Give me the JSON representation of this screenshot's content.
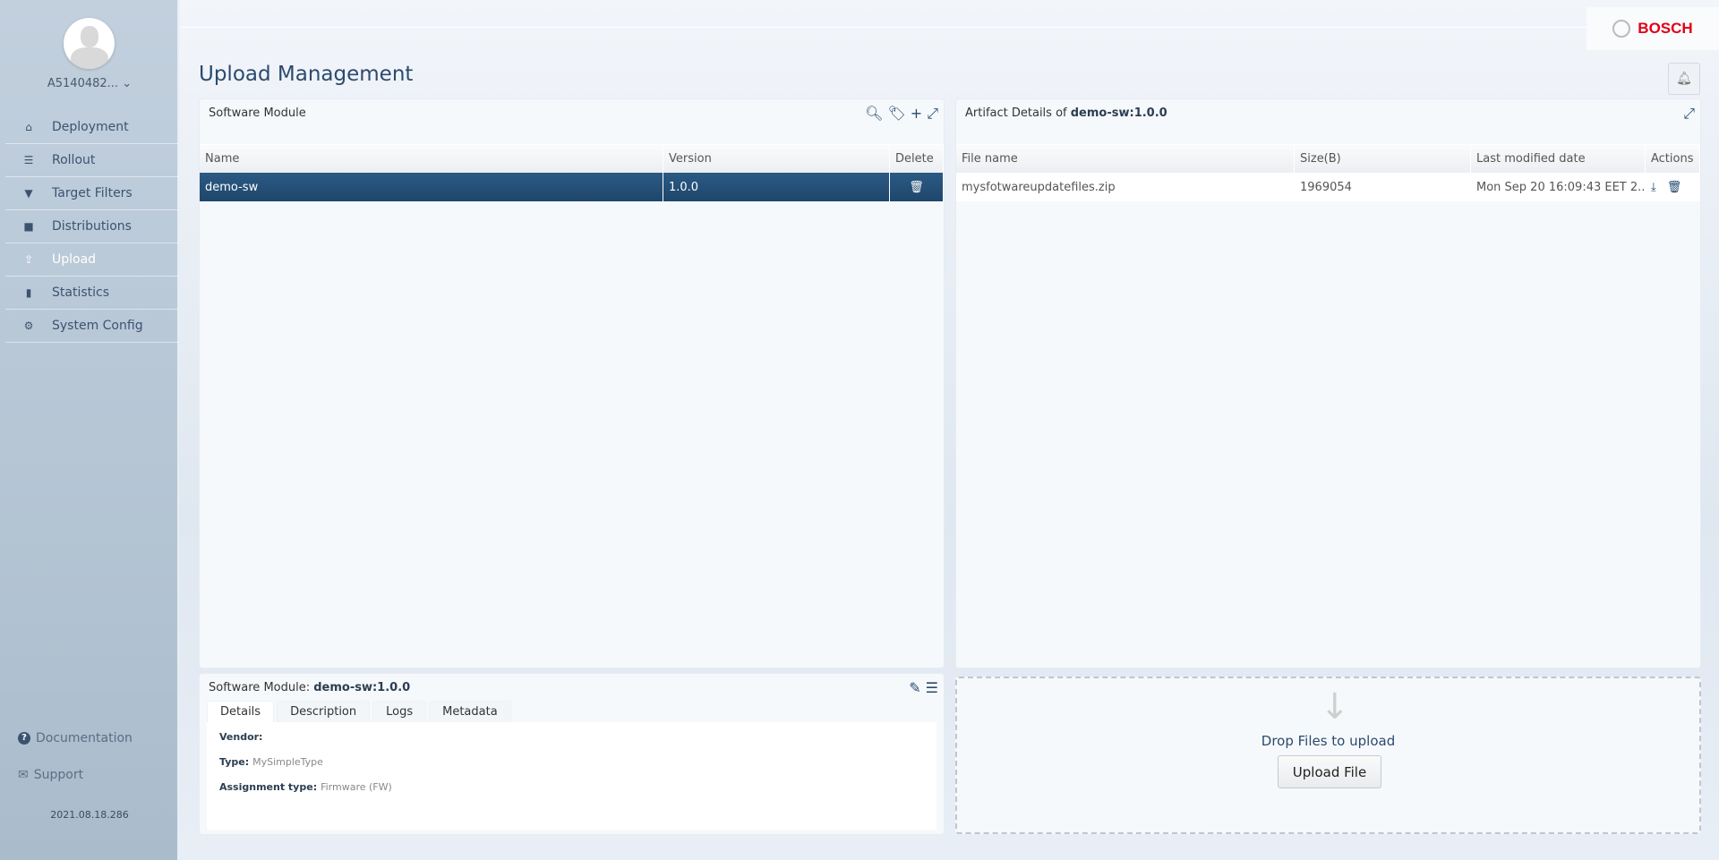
{
  "user": {
    "name": "A5140482..."
  },
  "sidebar": {
    "items": [
      {
        "label": "Deployment",
        "icon": "home-icon",
        "glyph": "⌂"
      },
      {
        "label": "Rollout",
        "icon": "list-icon",
        "glyph": "☰"
      },
      {
        "label": "Target Filters",
        "icon": "filter-icon",
        "glyph": "▼"
      },
      {
        "label": "Distributions",
        "icon": "briefcase-icon",
        "glyph": "■"
      },
      {
        "label": "Upload",
        "icon": "upload-icon",
        "glyph": "⇪"
      },
      {
        "label": "Statistics",
        "icon": "bar-chart-icon",
        "glyph": "▮"
      },
      {
        "label": "System Config",
        "icon": "gear-icon",
        "glyph": "⚙"
      }
    ],
    "active": "Upload",
    "documentation": "Documentation",
    "support": "Support",
    "version": "2021.08.18.286"
  },
  "brand": "BOSCH",
  "page": {
    "title": "Upload Management"
  },
  "software_module": {
    "title": "Software Module",
    "columns": [
      "Name",
      "Version",
      "Delete"
    ],
    "rows": [
      {
        "name": "demo-sw",
        "version": "1.0.0"
      }
    ]
  },
  "artifacts": {
    "title_prefix": "Artifact Details of",
    "title_value": "demo-sw:1.0.0",
    "columns": [
      "File name",
      "Size(B)",
      "Last modified date",
      "Actions"
    ],
    "rows": [
      {
        "file": "mysfotwareupdatefiles.zip",
        "size": "1969054",
        "modified": "Mon Sep 20 16:09:43 EET 2..."
      }
    ]
  },
  "details": {
    "title_prefix": "Software Module:",
    "title_value": "demo-sw:1.0.0",
    "tabs": [
      "Details",
      "Description",
      "Logs",
      "Metadata"
    ],
    "active_tab": "Details",
    "fields": [
      {
        "label": "Vendor:",
        "value": ""
      },
      {
        "label": "Type:",
        "value": "MySimpleType"
      },
      {
        "label": "Assignment type:",
        "value": "Firmware (FW)"
      }
    ]
  },
  "upload": {
    "drop_text": "Drop Files to upload",
    "button": "Upload File"
  },
  "colors": {
    "accent": "#1f466c",
    "brand": "#e20015",
    "title": "#2c4a6e"
  }
}
